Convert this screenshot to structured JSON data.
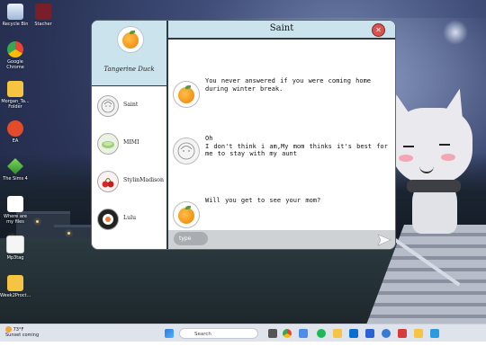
{
  "desktop": {
    "icons": [
      {
        "label": "Recycle Bin",
        "icon": "recycle-bin-icon"
      },
      {
        "label": "Stacher",
        "icon": "stacher-icon"
      },
      {
        "label": "Google Chrome",
        "icon": "chrome-icon"
      },
      {
        "label": "Morgan_Ta... Folder",
        "icon": "folder-icon"
      },
      {
        "label": "EA",
        "icon": "ea-icon"
      },
      {
        "label": "The Sims 4",
        "icon": "sims-icon"
      },
      {
        "label": "Where are my files",
        "icon": "file-icon"
      },
      {
        "label": "Mp3tag",
        "icon": "mp3tag-icon"
      },
      {
        "label": "Week2Proct...",
        "icon": "folder-icon"
      }
    ]
  },
  "chat": {
    "profile": {
      "name": "Tangerine Duck",
      "avatar": "orange-icon"
    },
    "contacts": [
      {
        "name": "Saint",
        "avatar": "sketch-face-icon"
      },
      {
        "name": "MIMI",
        "avatar": "matcha-icon"
      },
      {
        "name": "StylinMadison",
        "avatar": "cherry-icon"
      },
      {
        "name": "Lulu",
        "avatar": "sushi-icon"
      }
    ],
    "title": "Saint",
    "close_label": "✕",
    "messages": [
      {
        "sender": "Tangerine Duck",
        "text": "You never answered if you were coming home during winter break."
      },
      {
        "sender": "Saint",
        "text": "Oh\nI don't think i am,My mom thinks it's best for me to stay with my aunt"
      },
      {
        "sender": "Tangerine Duck",
        "text": "Will you get to see your mom?"
      }
    ],
    "input": {
      "placeholder": "type"
    }
  },
  "taskbar": {
    "weather_temp": "73°F",
    "weather_text": "Sunset coming",
    "search_placeholder": "Search"
  },
  "colors": {
    "header_bg": "#cbe3ec",
    "close_red": "#d9534f",
    "input_bar": "#cfd2d5"
  }
}
